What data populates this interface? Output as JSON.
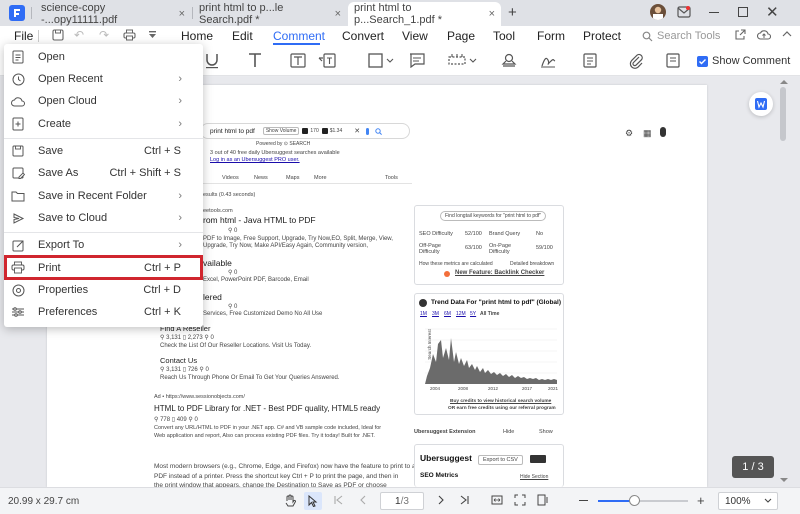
{
  "tabs": [
    {
      "label": "science-copy -...opy11111.pdf",
      "close": "×"
    },
    {
      "label": "print html to p...le Search.pdf *",
      "close": "×"
    },
    {
      "label": "print html to p...Search_1.pdf *",
      "close": "×"
    }
  ],
  "new_tab": "+",
  "menubar": {
    "file": "File",
    "items": [
      "Home",
      "Edit",
      "Comment",
      "Convert",
      "View",
      "Page",
      "Tool",
      "Form",
      "Protect"
    ],
    "active": "Comment",
    "search_tools": "Search Tools"
  },
  "toolbar": {
    "show_comment": "Show Comment"
  },
  "file_menu": [
    {
      "label": "Open",
      "shortcut": "",
      "arrow": ""
    },
    {
      "label": "Open Recent",
      "shortcut": "",
      "arrow": "›"
    },
    {
      "label": "Open Cloud",
      "shortcut": "",
      "arrow": "›"
    },
    {
      "label": "Create",
      "shortcut": "",
      "arrow": "›"
    },
    {
      "label": "Save",
      "shortcut": "Ctrl + S",
      "arrow": ""
    },
    {
      "label": "Save As",
      "shortcut": "Ctrl + Shift + S",
      "arrow": ""
    },
    {
      "label": "Save in Recent Folder",
      "shortcut": "",
      "arrow": "›"
    },
    {
      "label": "Save to Cloud",
      "shortcut": "",
      "arrow": "›"
    },
    {
      "label": "Export To",
      "shortcut": "",
      "arrow": "›"
    },
    {
      "label": "Print",
      "shortcut": "Ctrl + P",
      "arrow": ""
    },
    {
      "label": "Properties",
      "shortcut": "Ctrl + D",
      "arrow": ""
    },
    {
      "label": "Preferences",
      "shortcut": "Ctrl + K",
      "arrow": ""
    }
  ],
  "page_content": {
    "search_query": "print html to pdf",
    "show_volume": "Show Volume",
    "stat1": "170",
    "stat2": "$1.34",
    "powered_by": "Powered by ⊙ SEARCH",
    "free_searches": "3 out of 40 free daily Ubersuggest searches available",
    "login_link": "Log in as an Ubersuggest PRO user.",
    "filters": [
      "Videos",
      "News",
      "Maps",
      "More"
    ],
    "tools": "Tools",
    "results": "esults (0.43 seconds)",
    "site1": "eetools.com",
    "title1": "rom html - Java HTML to PDF",
    "stats1": "⚲ 0",
    "desc1a": "PDF to Image, Free Support, Upgrade, Try Now,EO, Split, Merge, View,",
    "desc1b": "Upgrade, Try Now, Make API/Easy Again, Community version,",
    "title2": "vailable",
    "stats2": "⚲ 0",
    "desc2": "Excel, PowerPoint PDF, Barcode, Email",
    "title3": "lered",
    "stats3": "⚲ 0",
    "desc3": "Services, Free Customized Demo No All Use",
    "title4": "Find A Reseller",
    "stats4a": "3,131",
    "stats4b": "2,273",
    "stats4c": "0",
    "desc4": "Check the List Of Our Reseller Locations. Visit Us Today.",
    "title5": "Contact Us",
    "stats5a": "3,131",
    "stats5b": "726",
    "stats5c": "0",
    "desc5": "Reach Us Through Phone Or Email To Get Your Queries Answered.",
    "ad_label": "Ad • https://www.sessionobjects.com/",
    "title6": "HTML to PDF Library for .NET - Best PDF quality, HTML5 ready",
    "stats6a": "778",
    "stats6b": "409",
    "stats6c": "0",
    "desc6a": "Convert any URL/HTML to PDF in your .NET app. C# and VB sample code included, Ideal for",
    "desc6b": "Web application and report, Also can process existing PDF files. Try it today! Built for .NET.",
    "para1": "Most modern browsers (e.g., Chrome, Edge, and Firefox) now have the feature to print to a",
    "para2": "PDF instead of a printer. Press the shortcut key Ctrl + P to print the page, and then in",
    "para3": "the print window that appears, change the Destination to Save as PDF or choose",
    "kw_find": "Find longtail keywords for \"print html to pdf\"",
    "seo_diff": "SEO Difficulty",
    "seo_diff_val": "52/100",
    "brand_query": "Brand Query",
    "brand_query_val": "No",
    "offpage": "Off-Page Difficulty",
    "offpage_val": "63/100",
    "onpage": "On-Page Difficulty",
    "onpage_val": "59/100",
    "how_calc": "How these metrics are calculated",
    "detailed": "Detailed breakdown",
    "new_feature": "New Feature: Backlink Checker",
    "trend_title": "Trend Data For \"print html to pdf\" (Global)",
    "trend_tabs": [
      "1M",
      "3M",
      "6M",
      "12M",
      "5Y",
      "All Time"
    ],
    "trend_ylabel": "Search Interest",
    "trend_x": [
      "2004",
      "2008",
      "2012",
      "2017",
      "2021"
    ],
    "trend_link1": "Buy credits to view historical search volume",
    "trend_link2": "OR earn free credits using our referral program",
    "ext_label": "Ubersuggest Extension",
    "hide": "Hide",
    "show": "Show",
    "uber_title": "Ubersuggest",
    "export_csv": "Export to CSV",
    "seo_metrics": "SEO Metrics",
    "hide_section": "Hide Section"
  },
  "page_badge": "1 / 3",
  "status": {
    "dimensions": "20.99 x 29.7 cm",
    "page_input": "1",
    "page_total": "/3",
    "zoom": "100%"
  }
}
